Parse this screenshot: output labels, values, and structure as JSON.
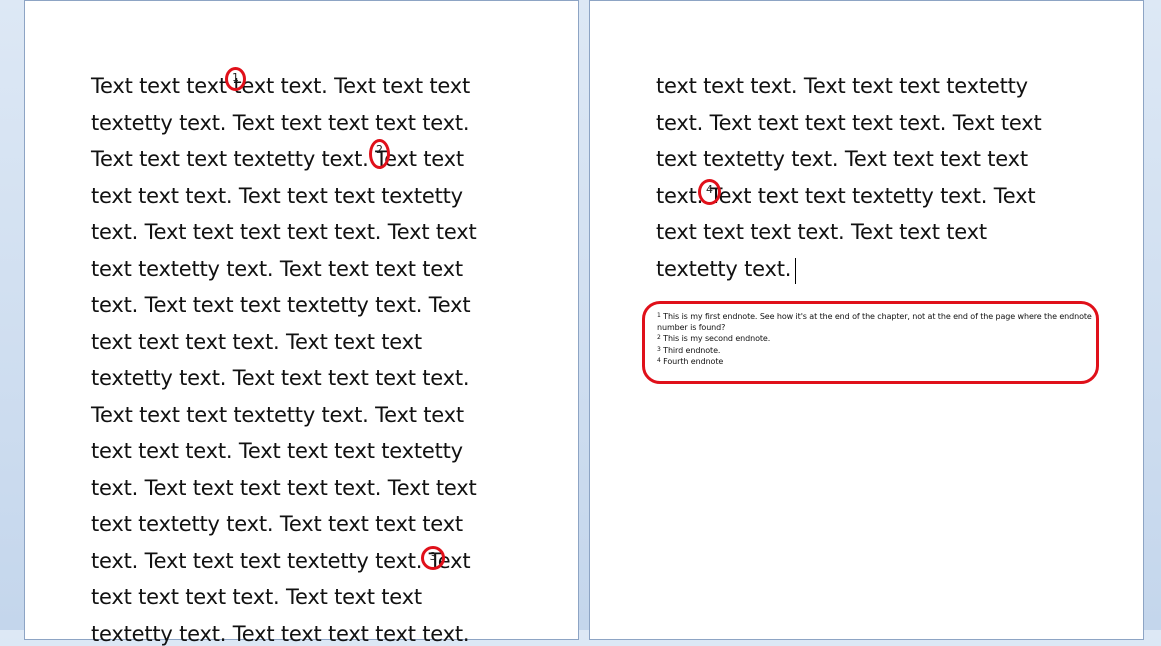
{
  "left_page": {
    "lines": [
      "Text text text   text text. Text text text",
      "textetty text. Text text text text text.",
      "Text text text textetty text.   Text text",
      "text text text. Text text text textetty",
      "text. Text text text text text. Text text",
      "text textetty text. Text text text text",
      "text. Text text text textetty text. Text",
      "text text text text. Text text text",
      "textetty text. Text text text text text.",
      "Text text text textetty text. Text text",
      "text text text. Text text text textetty",
      "text. Text text text text text. Text text",
      "text textetty text. Text text text text",
      "text. Text text text textetty text.   Text",
      "text text text text. Text text text",
      "textetty text. Text text text text text."
    ],
    "markers": [
      "1",
      "2",
      "3"
    ]
  },
  "right_page": {
    "lines": [
      "text text text. Text text text textetty",
      "text. Text text text text text. Text text",
      "text textetty text. Text text text text",
      "text.   Text text text textetty text. Text",
      "text text text text. Text text text",
      "textetty text."
    ],
    "markers": [
      "4"
    ],
    "endnotes": [
      {
        "num": "1",
        "text": "This is my first endnote. See how it's at the end of the chapter, not at the end of the page where the endnote"
      },
      {
        "num": "",
        "text": "number is found?"
      },
      {
        "num": "2",
        "text": "This is my second endnote."
      },
      {
        "num": "3",
        "text": "Third endnote."
      },
      {
        "num": "4",
        "text": "Fourth endnote"
      }
    ]
  },
  "colors": {
    "highlight": "#e0101a",
    "page": "#ffffff",
    "background": "#c4d6ec"
  }
}
